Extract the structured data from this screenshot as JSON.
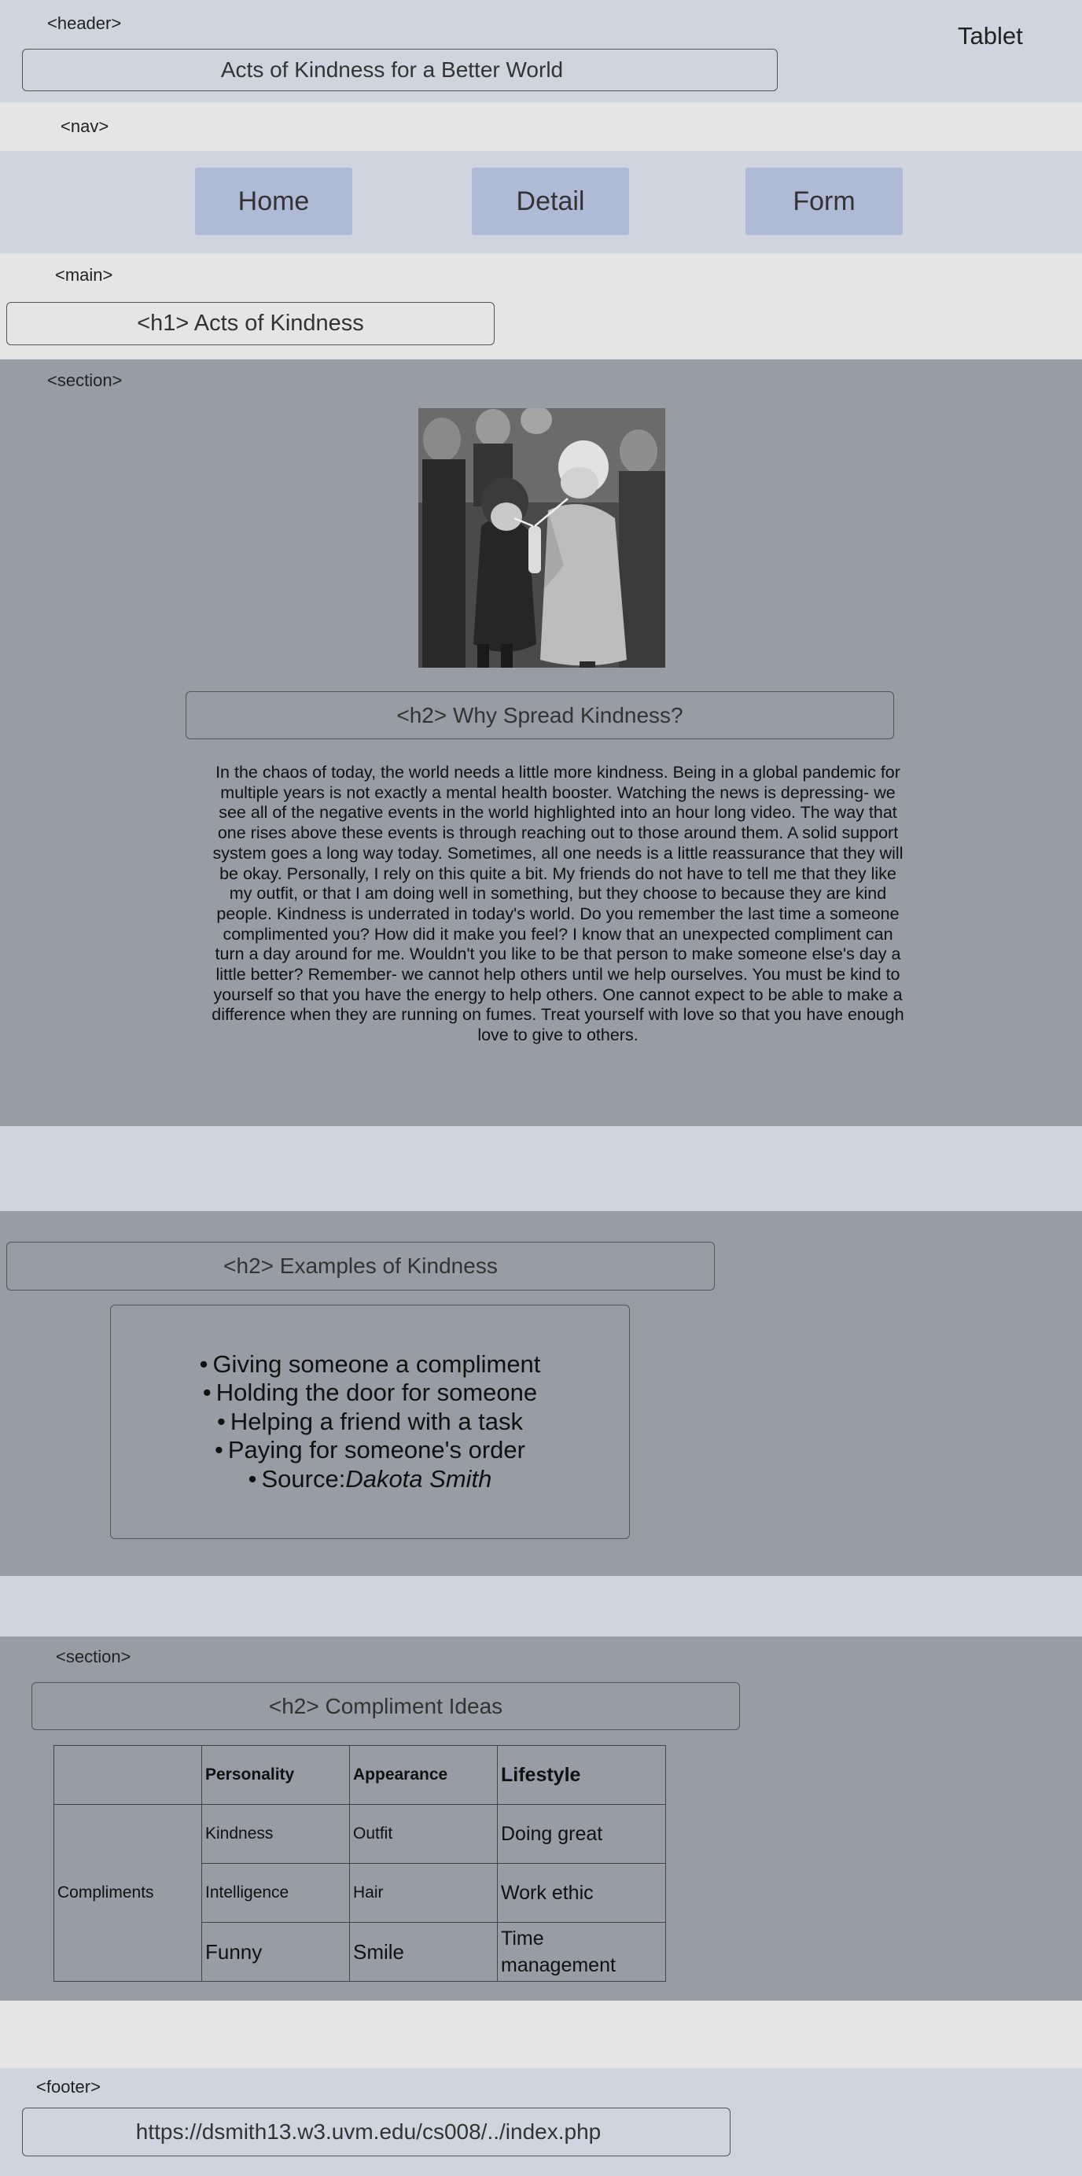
{
  "header": {
    "tag": "<header>",
    "device": "Tablet",
    "title": "Acts of Kindness for a Better World"
  },
  "nav": {
    "tag": "<nav>",
    "items": [
      {
        "label": "Home"
      },
      {
        "label": "Detail"
      },
      {
        "label": "Form"
      }
    ]
  },
  "main": {
    "tag": "<main>",
    "h1": "<h1> Acts of Kindness"
  },
  "section1": {
    "tag": "<section>",
    "h2": "<h2> Why Spread Kindness?",
    "paragraph": "In the chaos of today, the world needs a little more kindness. Being in a global pandemic for multiple years is not exactly a mental health booster. Watching the news is depressing- we see all of the negative events in the world highlighted into an hour long video. The way that one rises above these events is through reaching out to those around them. A solid support system goes a long way today. Sometimes, all one needs is a little reassurance that they will be okay. Personally, I rely on this quite a bit. My friends do not have to tell me that they like my outfit, or that I am doing well in something, but they choose to because they are kind people. Kindness is underrated in today's world. Do you remember the last time a someone complimented you? How did it make you feel? I know that an unexpected compliment can turn a day around for me. Wouldn't you like to be that person to make someone else's day a little better? Remember- we cannot help others until we help ourselves. You must be kind to yourself so that you have the energy to help others. One cannot expect to be able to make a difference when they are running on fumes. Treat yourself with love so that you have enough love to give to others."
  },
  "examples": {
    "h2": "<h2> Examples of Kindness",
    "items": [
      "Giving someone a compliment",
      "Holding the door for someone",
      "Helping a friend with a task",
      "Paying for someone's order"
    ],
    "source_label": "Source:",
    "source_name": "Dakota Smith"
  },
  "section2": {
    "tag": "<section>",
    "h2": "<h2> Compliment Ideas",
    "table": {
      "headers": [
        "",
        "Personality",
        "Appearance",
        "Lifestyle"
      ],
      "row_label": "Compliments",
      "rows": [
        [
          "Kindness",
          "Outfit",
          "Doing great"
        ],
        [
          "Intelligence",
          "Hair",
          "Work ethic"
        ],
        [
          "Funny",
          "Smile",
          "Time management"
        ]
      ]
    }
  },
  "footer": {
    "tag": "<footer>",
    "url": "https://dsmith13.w3.uvm.edu/cs008/../index.php"
  },
  "colors": {
    "light_band": "#cfd5de",
    "gray_band": "#e5e5e5",
    "section_band": "#979ca5",
    "nav_button": "#afbad6"
  }
}
